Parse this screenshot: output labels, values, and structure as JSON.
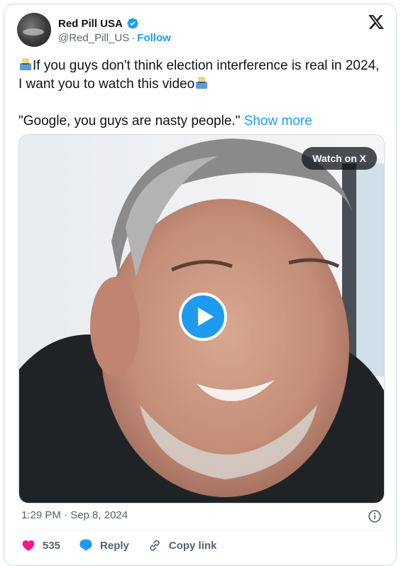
{
  "account": {
    "display_name": "Red Pill USA",
    "handle": "@Red_Pill_US",
    "separator": "·",
    "follow_label": "Follow"
  },
  "tweet": {
    "line1_text": "If you guys don't think election interference is real in 2024, I want you to watch this video",
    "line2_text": "\"Google, you guys are nasty people.\"",
    "show_more": "Show more",
    "emoji": "ballot-box-emoji"
  },
  "media": {
    "watch_label": "Watch on X",
    "play_icon": "play-icon"
  },
  "meta": {
    "timestamp": "1:29 PM · Sep 8, 2024"
  },
  "actions": {
    "like_count": "535",
    "reply_label": "Reply",
    "copy_link_label": "Copy link"
  },
  "colors": {
    "accent": "#1d9bf0",
    "like": "#f91880",
    "secondary_text": "#536471",
    "border": "#cfd9de"
  }
}
